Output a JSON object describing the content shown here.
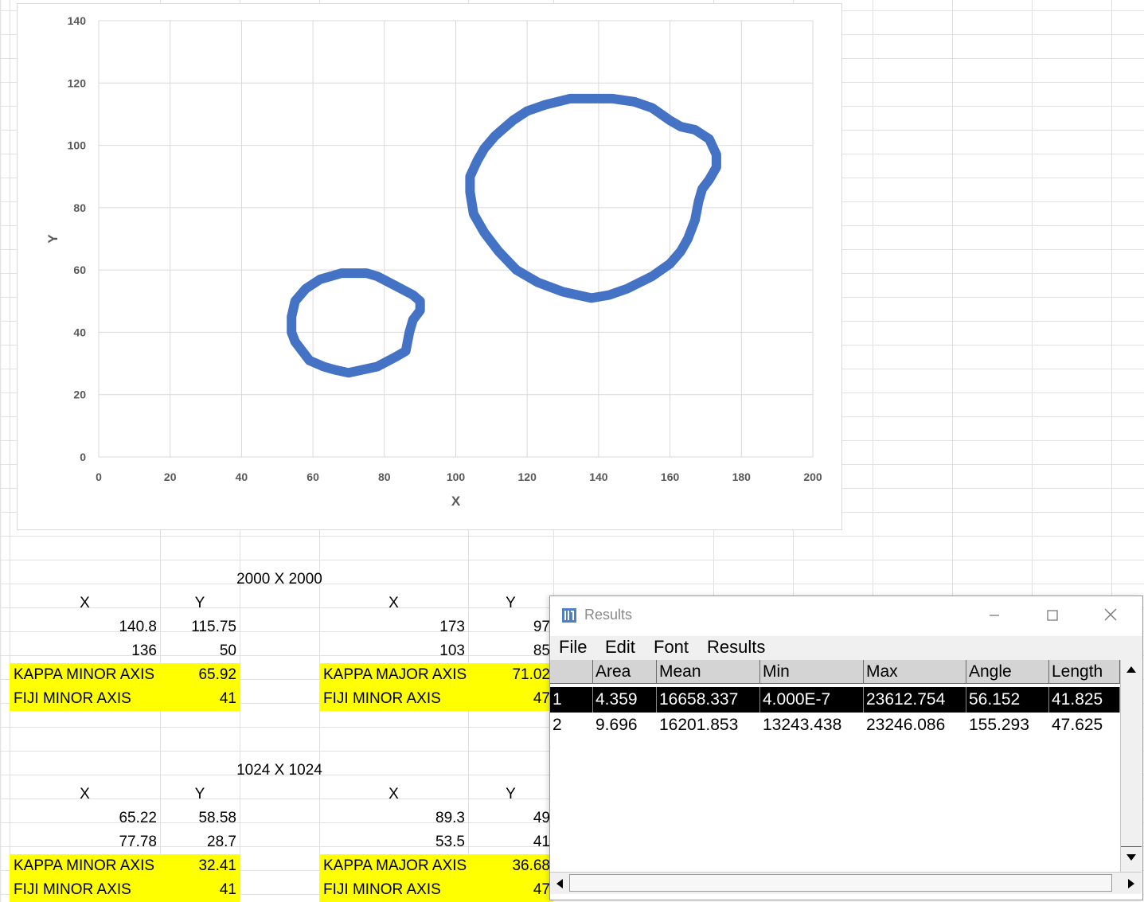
{
  "chart_data": {
    "type": "scatter",
    "title": "",
    "xlabel": "X",
    "ylabel": "Y",
    "xlim": [
      0,
      200
    ],
    "ylim": [
      0,
      140
    ],
    "xticks": [
      0,
      20,
      40,
      60,
      80,
      100,
      120,
      140,
      160,
      180,
      200
    ],
    "yticks": [
      0,
      20,
      40,
      60,
      80,
      100,
      120,
      140
    ],
    "grid": true,
    "series_color": "#4472c4",
    "series": [
      {
        "points": [
          [
            70,
            27
          ],
          [
            78,
            29
          ],
          [
            83,
            32
          ],
          [
            86,
            34
          ],
          [
            87,
            40
          ],
          [
            88,
            44
          ],
          [
            90,
            47
          ],
          [
            90,
            50
          ],
          [
            88,
            52
          ],
          [
            83,
            55
          ],
          [
            78,
            58
          ],
          [
            75,
            59
          ],
          [
            68,
            59
          ],
          [
            62,
            57
          ],
          [
            58,
            54
          ],
          [
            55,
            50
          ],
          [
            54,
            45
          ],
          [
            54,
            40
          ],
          [
            55,
            37
          ],
          [
            57,
            34
          ],
          [
            59,
            31
          ],
          [
            63,
            29
          ],
          [
            66,
            28
          ],
          [
            70,
            27
          ]
        ]
      },
      {
        "points": [
          [
            138,
            51
          ],
          [
            143,
            52
          ],
          [
            148,
            54
          ],
          [
            155,
            58
          ],
          [
            160,
            62
          ],
          [
            163,
            66
          ],
          [
            165,
            70
          ],
          [
            167,
            76
          ],
          [
            168,
            82
          ],
          [
            169,
            86
          ],
          [
            171,
            89
          ],
          [
            173,
            93
          ],
          [
            173,
            97
          ],
          [
            171,
            102
          ],
          [
            167,
            105
          ],
          [
            163,
            106
          ],
          [
            160,
            108
          ],
          [
            155,
            112
          ],
          [
            150,
            114
          ],
          [
            144,
            115
          ],
          [
            138,
            115
          ],
          [
            132,
            115
          ],
          [
            125,
            113
          ],
          [
            120,
            111
          ],
          [
            116,
            108
          ],
          [
            111,
            103
          ],
          [
            108,
            99
          ],
          [
            106,
            95
          ],
          [
            104,
            90
          ],
          [
            104,
            85
          ],
          [
            105,
            78
          ],
          [
            108,
            72
          ],
          [
            112,
            66
          ],
          [
            117,
            60
          ],
          [
            123,
            56
          ],
          [
            130,
            53
          ],
          [
            134,
            52
          ],
          [
            138,
            51
          ]
        ]
      }
    ]
  },
  "sheet": {
    "block1_title": "2000 X 2000",
    "block2_title": "1024 X 1024",
    "col_x": "X",
    "col_y": "Y",
    "b1": {
      "left_r1": [
        "140.8",
        "115.75"
      ],
      "left_r2": [
        "136",
        "50"
      ],
      "right_r1": [
        "173",
        "97"
      ],
      "right_r2": [
        "103",
        "85"
      ],
      "kappa_minor_label": "KAPPA MINOR AXIS",
      "kappa_minor_val": "65.92",
      "fiji_minor_label": "FIJI MINOR AXIS",
      "fiji_minor_val": "41",
      "kappa_major_label": "KAPPA MAJOR AXIS",
      "kappa_major_val": "71.02",
      "fiji_minor2_label": "FIJI MINOR AXIS",
      "fiji_minor2_val": "47"
    },
    "b2": {
      "left_r1": [
        "65.22",
        "58.58"
      ],
      "left_r2": [
        "77.78",
        "28.7"
      ],
      "right_r1": [
        "89.3",
        "49"
      ],
      "right_r2": [
        "53.5",
        "41"
      ],
      "kappa_minor_label": "KAPPA MINOR AXIS",
      "kappa_minor_val": "32.41",
      "fiji_minor_label": "FIJI MINOR AXIS",
      "fiji_minor_val": "41",
      "kappa_major_label": "KAPPA MAJOR AXIS",
      "kappa_major_val": "36.68",
      "fiji_minor2_label": "FIJI MINOR AXIS",
      "fiji_minor2_val": "47"
    }
  },
  "results_window": {
    "title": "Results",
    "menu": [
      "File",
      "Edit",
      "Font",
      "Results"
    ],
    "columns": [
      "",
      "Area",
      "Mean",
      "Min",
      "Max",
      "Angle",
      "Length"
    ],
    "rows": [
      [
        "1",
        "4.359",
        "16658.337",
        "4.000E-7",
        "23612.754",
        "56.152",
        "41.825"
      ],
      [
        "2",
        "9.696",
        "16201.853",
        "13243.438",
        "23246.086",
        "155.293",
        "47.625"
      ]
    ],
    "selected_row": 0
  }
}
